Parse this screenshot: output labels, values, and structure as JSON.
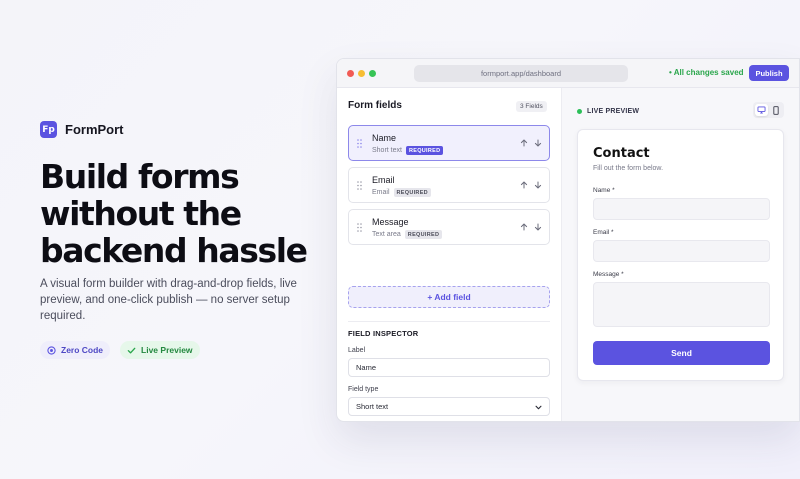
{
  "brand": {
    "logo_text": "Fp",
    "name": "FormPort"
  },
  "hero": {
    "headline": "Build forms without the backend hassle",
    "subtext": "A visual form builder with drag-and-drop fields, live preview, and one-click publish — no server setup required.",
    "chips": [
      {
        "label": "Zero Code",
        "icon": "target-icon"
      },
      {
        "label": "Live Preview",
        "icon": "check-icon"
      }
    ]
  },
  "window": {
    "url": "formport.app/dashboard",
    "saved_status": "• All changes saved",
    "publish_label": "Publish"
  },
  "builder": {
    "title": "Form fields",
    "count": "3 Fields",
    "fields": [
      {
        "name": "Name",
        "type": "Short text",
        "badge": "REQUIRED",
        "selected": true
      },
      {
        "name": "Email",
        "type": "Email",
        "badge": "REQUIRED",
        "selected": false
      },
      {
        "name": "Message",
        "type": "Text area",
        "badge": "REQUIRED",
        "selected": false
      }
    ],
    "add_field_label": "+ Add field"
  },
  "inspector": {
    "title": "FIELD INSPECTOR",
    "label_caption": "Label",
    "label_value": "Name",
    "type_caption": "Field type",
    "type_value": "Short text"
  },
  "preview": {
    "label": "LIVE PREVIEW",
    "devices": [
      "desktop-icon",
      "mobile-icon"
    ],
    "form_title": "Contact",
    "form_subtitle": "Fill out the form below.",
    "fields": [
      {
        "label": "Name *"
      },
      {
        "label": "Email *"
      },
      {
        "label": "Message *"
      }
    ],
    "submit_label": "Send"
  },
  "colors": {
    "accent": "#5b53e0",
    "success": "#2aa64c",
    "heading": "#0d0d14"
  }
}
